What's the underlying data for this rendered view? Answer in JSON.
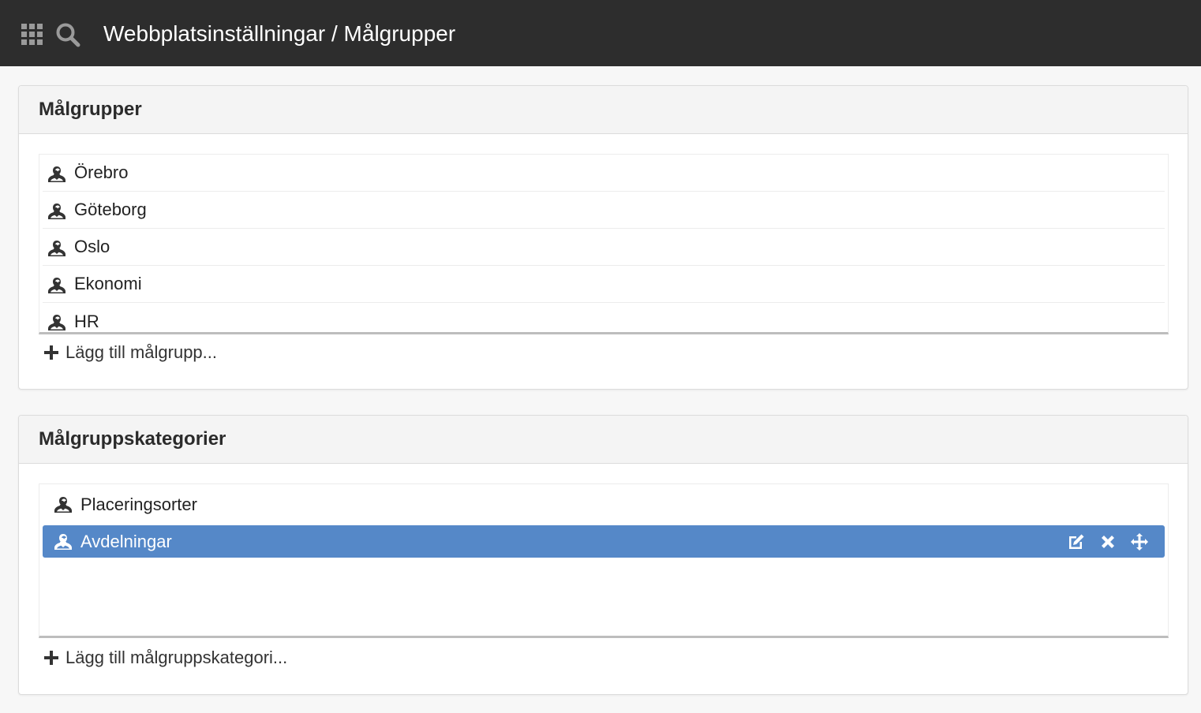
{
  "header": {
    "title": "Webbplatsinställningar / Målgrupper",
    "apps_icon": "grid-icon",
    "search_icon": "search-icon",
    "background": "#2d2d2d"
  },
  "audiences": {
    "title": "Målgrupper",
    "items": [
      {
        "label": "Örebro",
        "icon": "person-icon"
      },
      {
        "label": "Göteborg",
        "icon": "person-icon"
      },
      {
        "label": "Oslo",
        "icon": "person-icon"
      },
      {
        "label": "Ekonomi",
        "icon": "person-icon"
      },
      {
        "label": "HR",
        "icon": "person-icon"
      }
    ],
    "add_label": "Lägg till målgrupp..."
  },
  "categories": {
    "title": "Målgruppskategorier",
    "items": [
      {
        "label": "Placeringsorter",
        "icon": "person-icon",
        "selected": false
      },
      {
        "label": "Avdelningar",
        "icon": "person-icon",
        "selected": true
      }
    ],
    "row_actions": [
      "edit-icon",
      "close-icon",
      "move-icon"
    ],
    "add_label": "Lägg till målgruppskategori...",
    "selected_color": "#5588c8"
  }
}
